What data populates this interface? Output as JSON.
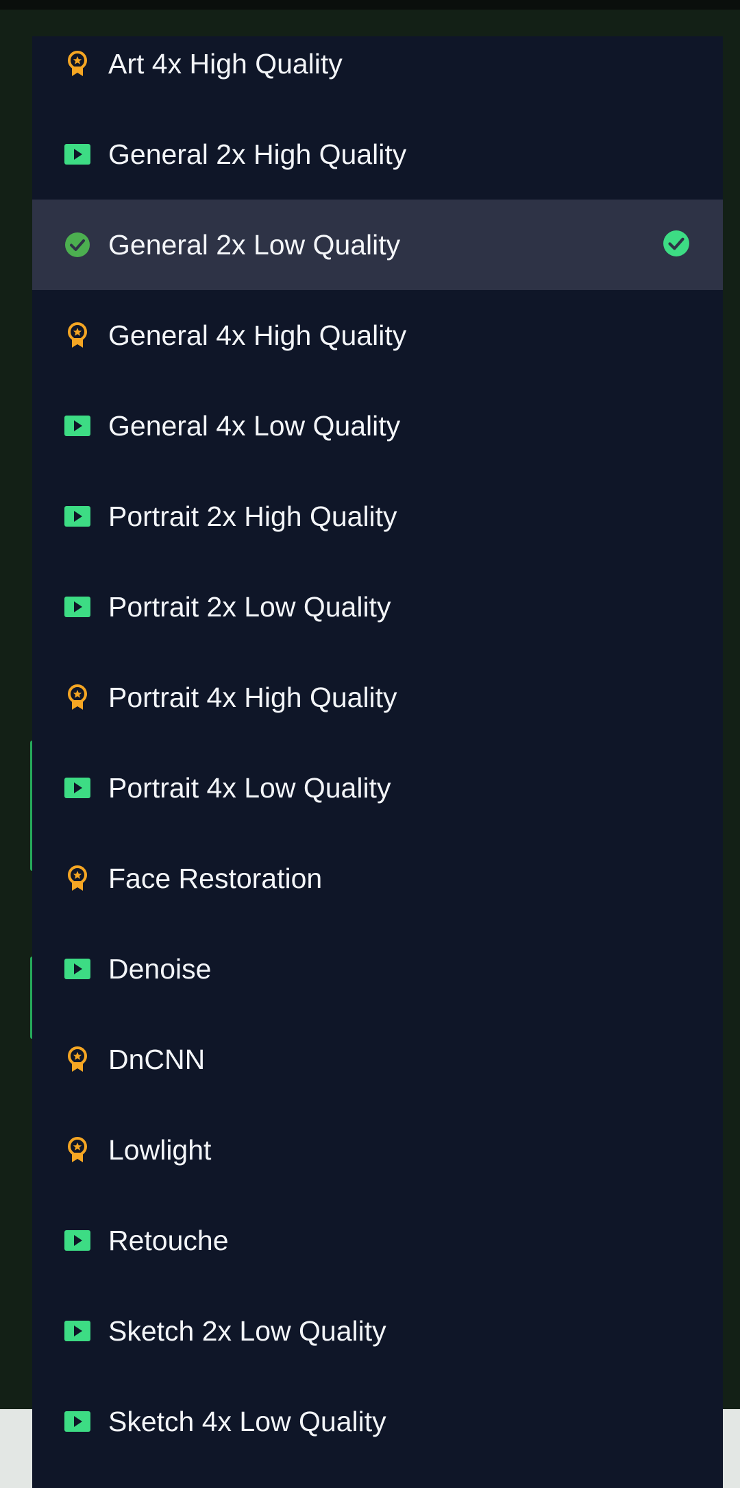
{
  "colors": {
    "page_background": "#132016",
    "menu_background": "#0f1628",
    "selected_background": "#2e3346",
    "text": "#f3f5f8",
    "green": "#3ddc84",
    "check_green": "#4caf50",
    "orange": "#f5a623"
  },
  "menu": {
    "items": [
      {
        "label": "Art 4x High Quality",
        "icon": "award-badge-icon"
      },
      {
        "label": "General 2x High Quality",
        "icon": "play-icon"
      },
      {
        "label": "General 2x Low Quality",
        "icon": "check-circle-icon",
        "selected": true
      },
      {
        "label": "General 4x High Quality",
        "icon": "award-badge-icon"
      },
      {
        "label": "General 4x Low Quality",
        "icon": "play-icon"
      },
      {
        "label": "Portrait 2x High Quality",
        "icon": "play-icon"
      },
      {
        "label": "Portrait 2x Low Quality",
        "icon": "play-icon"
      },
      {
        "label": "Portrait 4x High Quality",
        "icon": "award-badge-icon"
      },
      {
        "label": "Portrait 4x Low Quality",
        "icon": "play-icon"
      },
      {
        "label": "Face Restoration",
        "icon": "award-badge-icon"
      },
      {
        "label": "Denoise",
        "icon": "play-icon"
      },
      {
        "label": "DnCNN",
        "icon": "award-badge-icon"
      },
      {
        "label": "Lowlight",
        "icon": "award-badge-icon"
      },
      {
        "label": "Retouche",
        "icon": "play-icon"
      },
      {
        "label": "Sketch 2x Low Quality",
        "icon": "play-icon"
      },
      {
        "label": "Sketch 4x Low Quality",
        "icon": "play-icon"
      }
    ]
  }
}
